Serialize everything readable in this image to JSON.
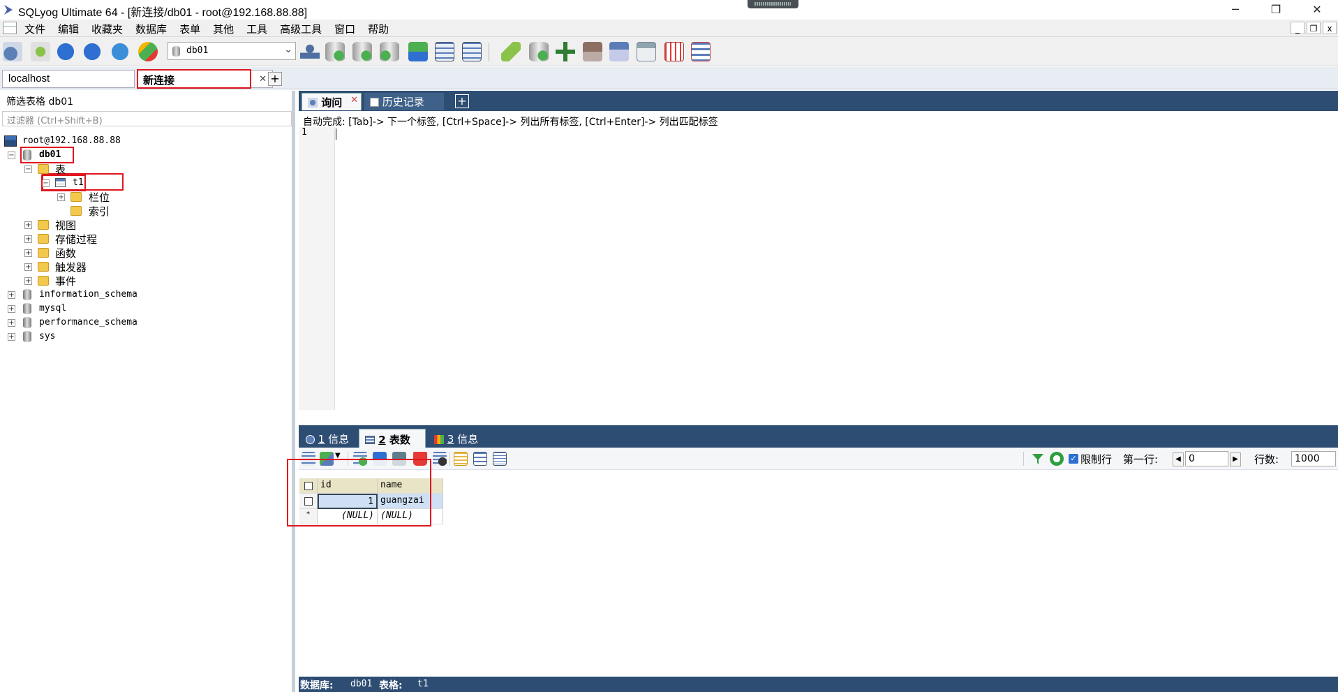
{
  "window": {
    "title": "SQLyog Ultimate 64 - [新连接/db01 - root@192.168.88.88]",
    "minimize": "─",
    "maximize": "❐",
    "close": "✕"
  },
  "menu": {
    "items": [
      "文件",
      "编辑",
      "收藏夹",
      "数据库",
      "表单",
      "其他",
      "工具",
      "高级工具",
      "窗口",
      "帮助"
    ],
    "mdi_min": "_",
    "mdi_restore": "❐",
    "mdi_close": "x"
  },
  "toolbar": {
    "database_select": "db01"
  },
  "connection_tabs": {
    "tabs": [
      "localhost",
      "新连接"
    ],
    "close": "✕",
    "add": "+"
  },
  "object_browser": {
    "filter_title": "筛选表格 db01",
    "filter_placeholder": "过滤器 (Ctrl+Shift+B)",
    "tree": {
      "server": "root@192.168.88.88",
      "db01": "db01",
      "tables_folder": "表",
      "table_t1": "t1",
      "columns_folder": "栏位",
      "indexes_folder": "索引",
      "views_folder": "视图",
      "procedures_folder": "存储过程",
      "functions_folder": "函数",
      "triggers_folder": "触发器",
      "events_folder": "事件",
      "other_dbs": [
        "information_schema",
        "mysql",
        "performance_schema",
        "sys"
      ]
    }
  },
  "query_tabs": {
    "query": "询问",
    "history": "历史记录",
    "close": "✕",
    "add": "+"
  },
  "editor": {
    "autocomplete_hint": "自动完成: [Tab]-> 下一个标签, [Ctrl+Space]-> 列出所有标签, [Ctrl+Enter]-> 列出匹配标签",
    "line_number": "1"
  },
  "result_tabs": {
    "tab1_num": "1",
    "tab1_label": " 信息",
    "tab2_num": "2",
    "tab2_label": " 表数据",
    "tab3_num": "3",
    "tab3_label": " 信息"
  },
  "result_toolbar": {
    "limit_rows_label": "限制行",
    "first_row_label": "第一行:",
    "first_row_value": "0",
    "row_count_label": "行数:",
    "row_count_value": "1000"
  },
  "grid": {
    "columns": [
      "id",
      "name"
    ],
    "rows": [
      {
        "id": "1",
        "name": "guangzai"
      },
      {
        "id": "(NULL)",
        "name": "(NULL)"
      }
    ],
    "new_row_marker": "*"
  },
  "status": {
    "db_label": "数据库:",
    "db_value": "db01",
    "table_label": "表格:",
    "table_value": "t1"
  }
}
